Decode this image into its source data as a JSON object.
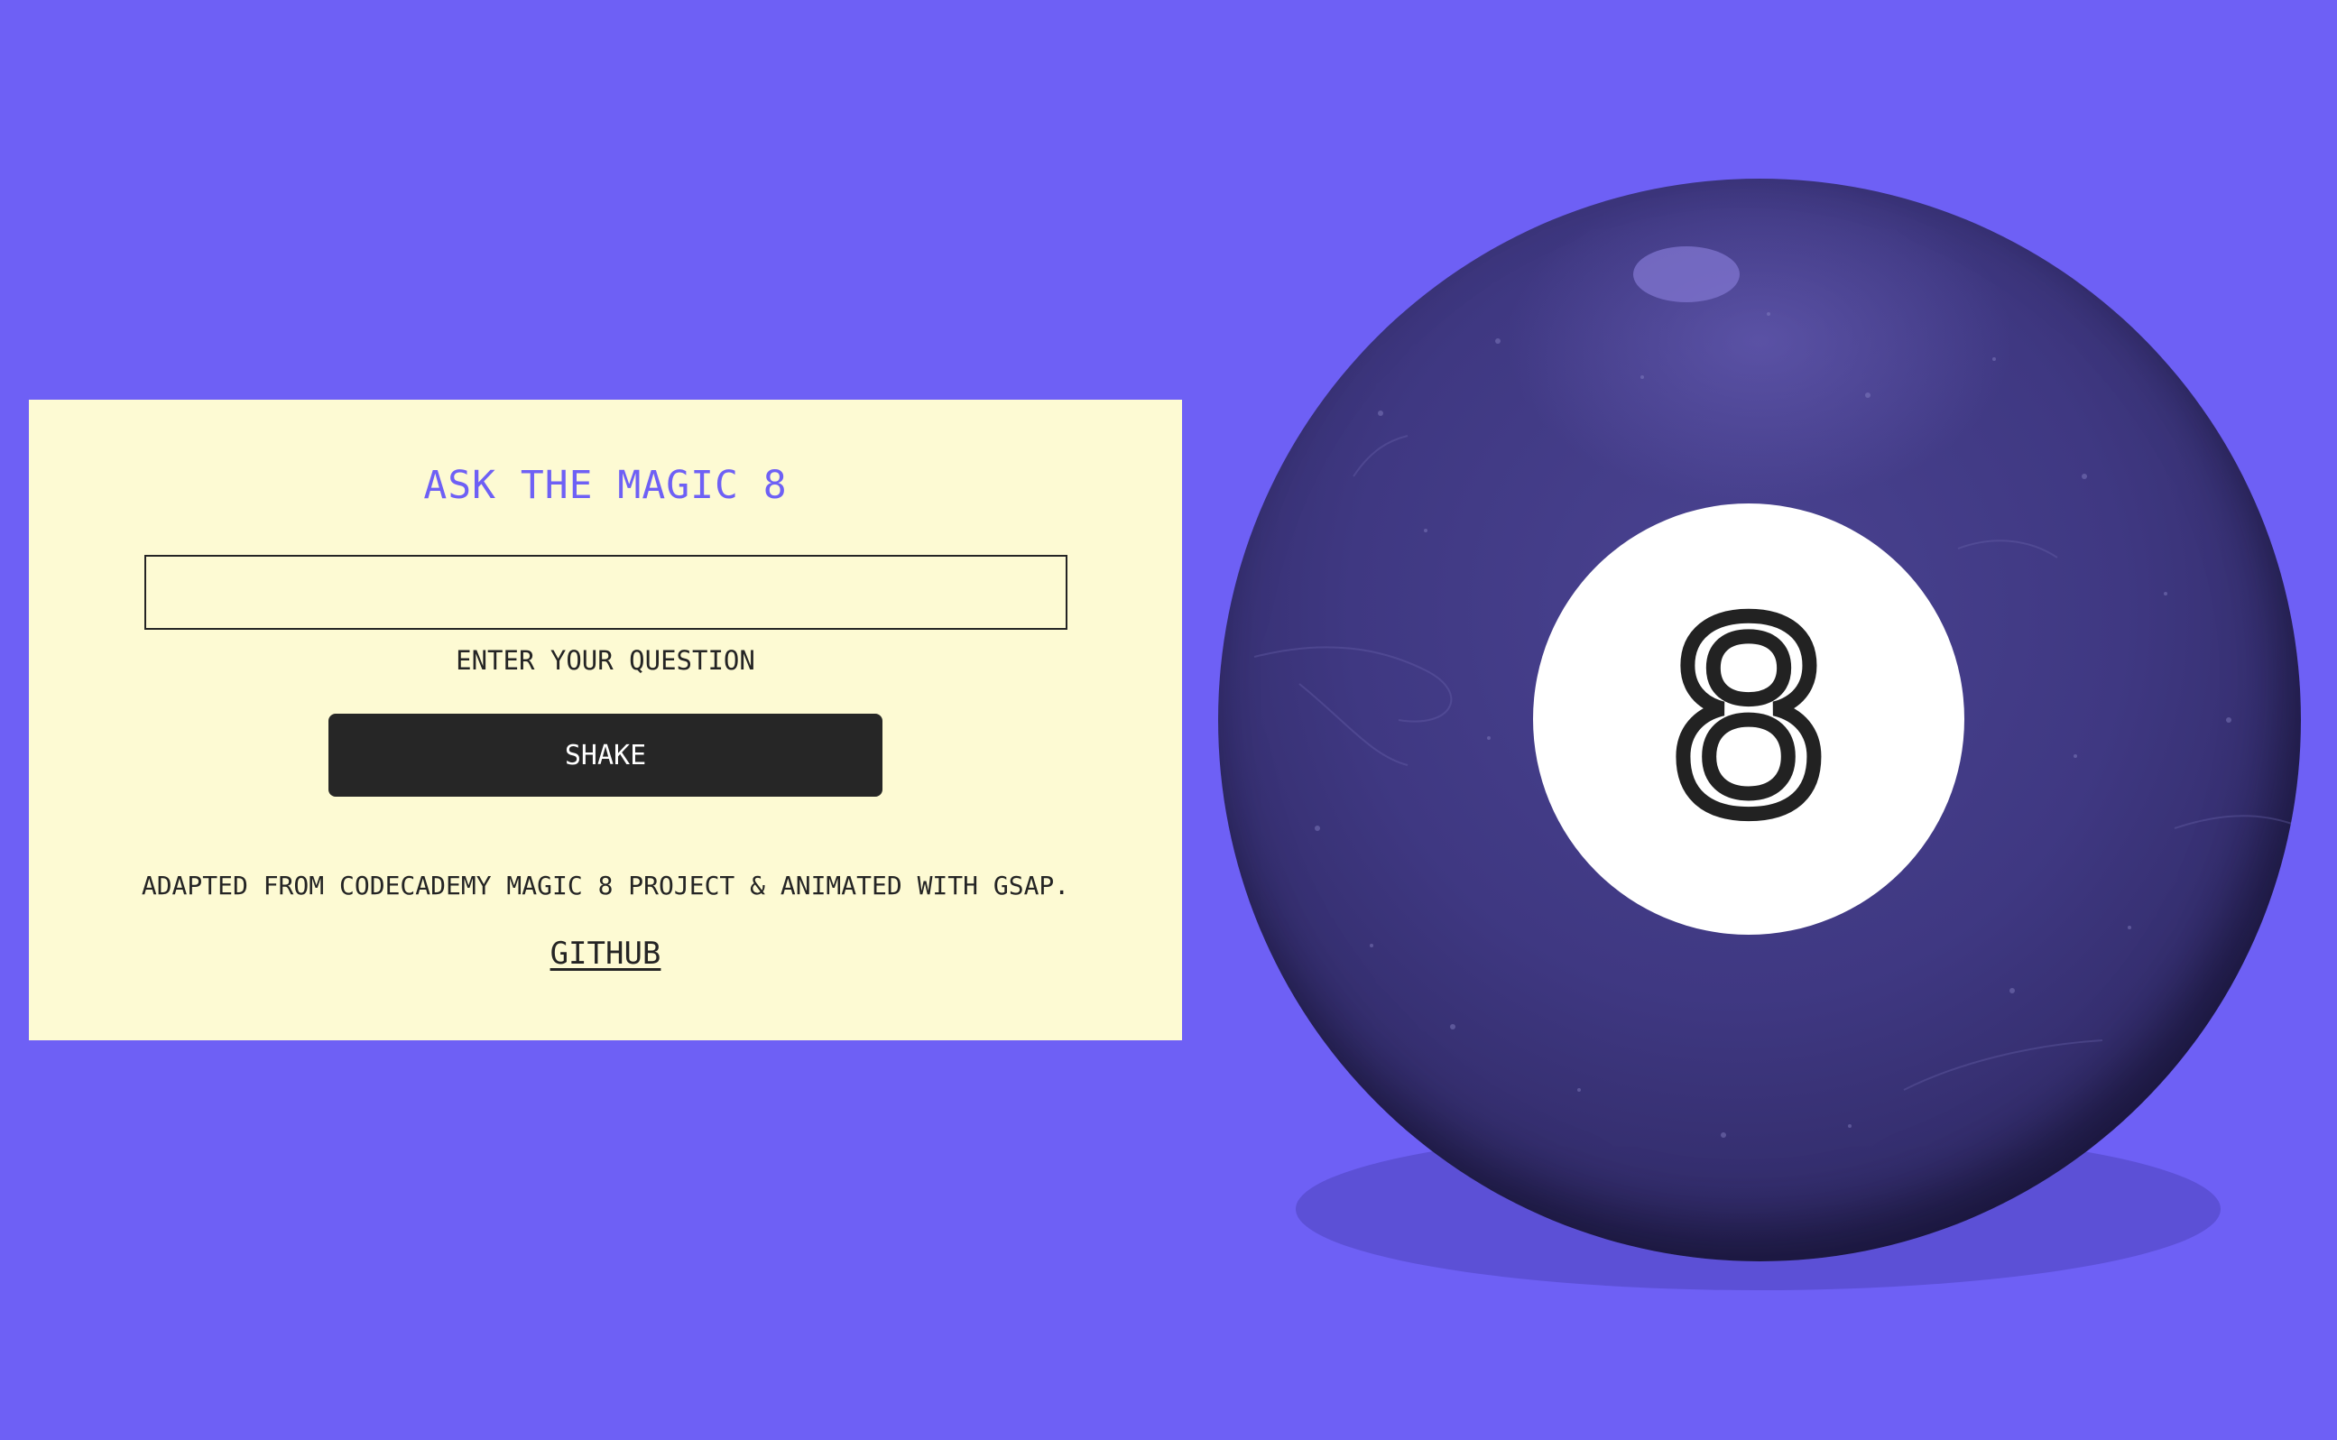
{
  "panel": {
    "title": "ASK THE MAGIC 8",
    "question_input": {
      "value": "",
      "placeholder": ""
    },
    "input_label": "ENTER YOUR QUESTION",
    "shake_label": "SHAKE",
    "credit": "ADAPTED FROM CODECADEMY MAGIC 8 PROJECT & ANIMATED WITH GSAP.",
    "github_label": "GITHUB"
  },
  "ball": {
    "number": "8"
  },
  "colors": {
    "background": "#6e60f5",
    "panel": "#fdfad3",
    "accent": "#6e60f5",
    "button": "#262626",
    "ball": "#3f3882"
  }
}
